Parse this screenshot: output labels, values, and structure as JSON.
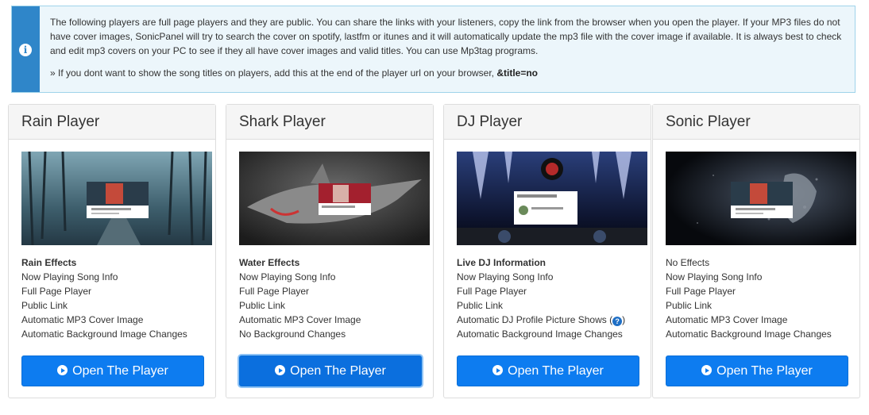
{
  "info": {
    "paragraph": "The following players are full page players and they are public. You can share the links with your listeners, copy the link from the browser when you open the player. If your MP3 files do not have cover images, SonicPanel will try to search the cover on spotify, lastfm or itunes and it will automatically update the mp3 file with the cover image if available. It is always best to check and edit mp3 covers on your PC to see if they all have cover images and valid titles. You can use Mp3tag programs.",
    "note_text": "» If you dont want to show the song titles on players, add this at the end of the player url on your browser, ",
    "note_code": "&title=no",
    "icon": "info-icon"
  },
  "players": [
    {
      "title": "Rain Player",
      "features": [
        "Rain Effects",
        "Now Playing Song Info",
        "Full Page Player",
        "Public Link",
        "Automatic MP3 Cover Image",
        "Automatic Background Image Changes"
      ],
      "button": "Open The Player"
    },
    {
      "title": "Shark Player",
      "features": [
        "Water Effects",
        "Now Playing Song Info",
        "Full Page Player",
        "Public Link",
        "Automatic MP3 Cover Image",
        "No Background Changes"
      ],
      "button": "Open The Player"
    },
    {
      "title": "DJ Player",
      "features": [
        "Live DJ Information",
        "Now Playing Song Info",
        "Full Page Player",
        "Public Link",
        "Automatic DJ Profile Picture Shows (",
        "Automatic Background Image Changes"
      ],
      "help_tail": ")",
      "button": "Open The Player"
    },
    {
      "title": "Sonic Player",
      "features": [
        "No Effects",
        "Now Playing Song Info",
        "Full Page Player",
        "Public Link",
        "Automatic MP3 Cover Image",
        "Automatic Background Image Changes"
      ],
      "button": "Open The Player"
    }
  ],
  "colors": {
    "accent": "#0d7cf0",
    "info_bar": "#2f86c9",
    "info_bg": "#ecf6fb"
  }
}
